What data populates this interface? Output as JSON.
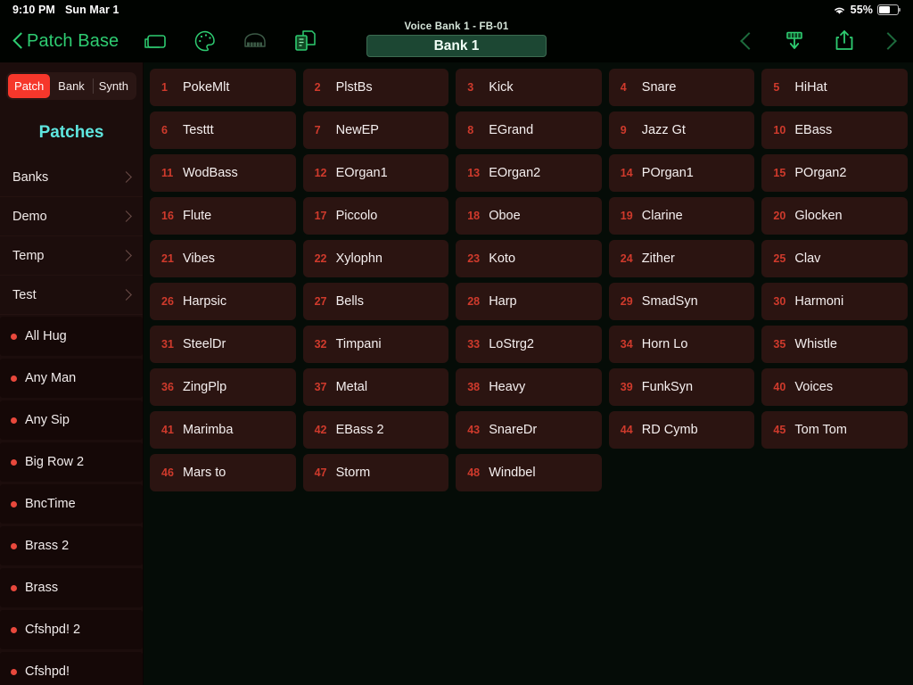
{
  "statusbar": {
    "time": "9:10 PM",
    "date": "Sun Mar 1",
    "wifi_icon": "wifi-icon",
    "battery_percent": "55%",
    "battery_level": 55
  },
  "toolbar": {
    "back_label": "Patch Base",
    "back_icon": "chevron-left-icon",
    "icons": [
      {
        "name": "window-icon",
        "enabled": true
      },
      {
        "name": "palette-icon",
        "enabled": true
      },
      {
        "name": "piano-icon",
        "enabled": false
      },
      {
        "name": "copy-document-icon",
        "enabled": true
      }
    ],
    "subtitle": "Voice Bank 1 - FB-01",
    "bank_label": "Bank 1",
    "right_icons": [
      {
        "name": "chevron-left-nav-icon",
        "enabled": false
      },
      {
        "name": "download-icon",
        "enabled": true
      },
      {
        "name": "share-icon",
        "enabled": true
      },
      {
        "name": "chevron-right-nav-icon",
        "enabled": false
      }
    ]
  },
  "sidebar": {
    "segments": [
      {
        "label": "Patch",
        "active": true
      },
      {
        "label": "Bank",
        "active": false
      },
      {
        "label": "Synth",
        "active": false
      }
    ],
    "title": "Patches",
    "nav_items": [
      {
        "label": "Banks",
        "icon": "chevron-right-icon"
      },
      {
        "label": "Demo",
        "icon": "chevron-right-icon"
      },
      {
        "label": "Temp",
        "icon": "chevron-right-icon"
      },
      {
        "label": "Test",
        "icon": "chevron-right-icon"
      }
    ],
    "patches": [
      {
        "label": "All Hug",
        "dot": "#e8483c"
      },
      {
        "label": "Any Man",
        "dot": "#e8483c"
      },
      {
        "label": "Any Sip",
        "dot": "#e8483c"
      },
      {
        "label": "Big Row 2",
        "dot": "#e8483c"
      },
      {
        "label": "BncTime",
        "dot": "#e8483c"
      },
      {
        "label": "Brass 2",
        "dot": "#e8483c"
      },
      {
        "label": "Brass",
        "dot": "#e8483c"
      },
      {
        "label": "Cfshpd! 2",
        "dot": "#e8483c"
      },
      {
        "label": "Cfshpd!",
        "dot": "#e8483c"
      }
    ]
  },
  "grid": {
    "cells": [
      {
        "num": "1",
        "name": "PokeMlt"
      },
      {
        "num": "2",
        "name": "PlstBs"
      },
      {
        "num": "3",
        "name": "Kick"
      },
      {
        "num": "4",
        "name": "Snare"
      },
      {
        "num": "5",
        "name": "HiHat"
      },
      {
        "num": "6",
        "name": "Testtt"
      },
      {
        "num": "7",
        "name": "NewEP"
      },
      {
        "num": "8",
        "name": "EGrand"
      },
      {
        "num": "9",
        "name": "Jazz Gt"
      },
      {
        "num": "10",
        "name": "EBass"
      },
      {
        "num": "11",
        "name": "WodBass"
      },
      {
        "num": "12",
        "name": "EOrgan1"
      },
      {
        "num": "13",
        "name": "EOrgan2"
      },
      {
        "num": "14",
        "name": "POrgan1"
      },
      {
        "num": "15",
        "name": "POrgan2"
      },
      {
        "num": "16",
        "name": "Flute"
      },
      {
        "num": "17",
        "name": "Piccolo"
      },
      {
        "num": "18",
        "name": "Oboe"
      },
      {
        "num": "19",
        "name": "Clarine"
      },
      {
        "num": "20",
        "name": "Glocken"
      },
      {
        "num": "21",
        "name": "Vibes"
      },
      {
        "num": "22",
        "name": "Xylophn"
      },
      {
        "num": "23",
        "name": "Koto"
      },
      {
        "num": "24",
        "name": "Zither"
      },
      {
        "num": "25",
        "name": "Clav"
      },
      {
        "num": "26",
        "name": "Harpsic"
      },
      {
        "num": "27",
        "name": "Bells"
      },
      {
        "num": "28",
        "name": "Harp"
      },
      {
        "num": "29",
        "name": "SmadSyn"
      },
      {
        "num": "30",
        "name": "Harmoni"
      },
      {
        "num": "31",
        "name": "SteelDr"
      },
      {
        "num": "32",
        "name": "Timpani"
      },
      {
        "num": "33",
        "name": "LoStrg2"
      },
      {
        "num": "34",
        "name": "Horn Lo"
      },
      {
        "num": "35",
        "name": "Whistle"
      },
      {
        "num": "36",
        "name": "ZingPlp"
      },
      {
        "num": "37",
        "name": "Metal"
      },
      {
        "num": "38",
        "name": "Heavy"
      },
      {
        "num": "39",
        "name": "FunkSyn"
      },
      {
        "num": "40",
        "name": "Voices"
      },
      {
        "num": "41",
        "name": "Marimba"
      },
      {
        "num": "42",
        "name": "EBass 2"
      },
      {
        "num": "43",
        "name": "SnareDr"
      },
      {
        "num": "44",
        "name": "RD Cymb"
      },
      {
        "num": "45",
        "name": "Tom Tom"
      },
      {
        "num": "46",
        "name": "Mars to"
      },
      {
        "num": "47",
        "name": "Storm"
      },
      {
        "num": "48",
        "name": "Windbel"
      }
    ]
  },
  "colors": {
    "accent_red": "#f6372b",
    "accent_green": "#2ecc71",
    "accent_cyan": "#5fe6e0",
    "cell_bg": "#2b1411",
    "cell_num": "#cf3a2c",
    "bank_bg": "#1c4733"
  }
}
